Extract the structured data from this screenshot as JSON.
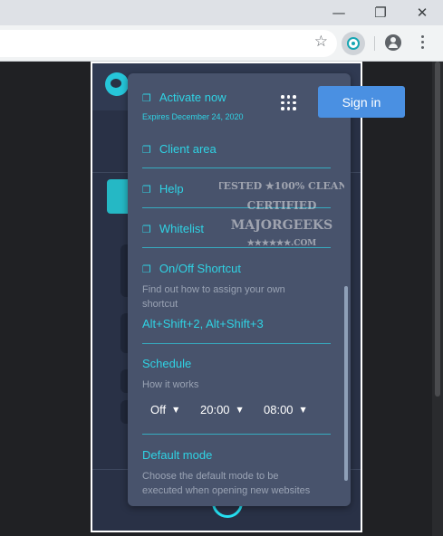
{
  "browser": {
    "window_controls": {
      "minimize": "—",
      "maximize": "❐",
      "close": "✕"
    },
    "star_glyph": "☆"
  },
  "menu": {
    "activate": {
      "label": "Activate now",
      "expires": "Expires December 24, 2020"
    },
    "client_area": "Client area",
    "help": "Help",
    "whitelist": "Whitelist",
    "shortcut": {
      "label": "On/Off Shortcut",
      "desc_line1": "Find out how to assign your own",
      "desc_line2": "shortcut",
      "keys": "Alt+Shift+2, Alt+Shift+3"
    },
    "schedule": {
      "label": "Schedule",
      "how": "How it works",
      "state": "Off",
      "from": "20:00",
      "to": "08:00"
    },
    "default_mode": {
      "label": "Default mode",
      "desc_line1": "Choose the default mode to be",
      "desc_line2": "executed when opening new websites"
    }
  },
  "sign_in_label": "Sign in",
  "watermark": {
    "line1": "TESTED ★100% CLEAN",
    "line2": "CERTIFIED",
    "line3": "MAJORGEEKS",
    "line4": "★★★★★★.COM"
  },
  "colors": {
    "accent": "#2fd3e4",
    "menu_bg": "#48536c",
    "popup_bg": "#293146",
    "signin_bg": "#4a90e2"
  },
  "icons": {
    "menu_items": "external-link-icon",
    "apps": "apps-grid-icon",
    "extension": "night-eye-extension-icon"
  }
}
